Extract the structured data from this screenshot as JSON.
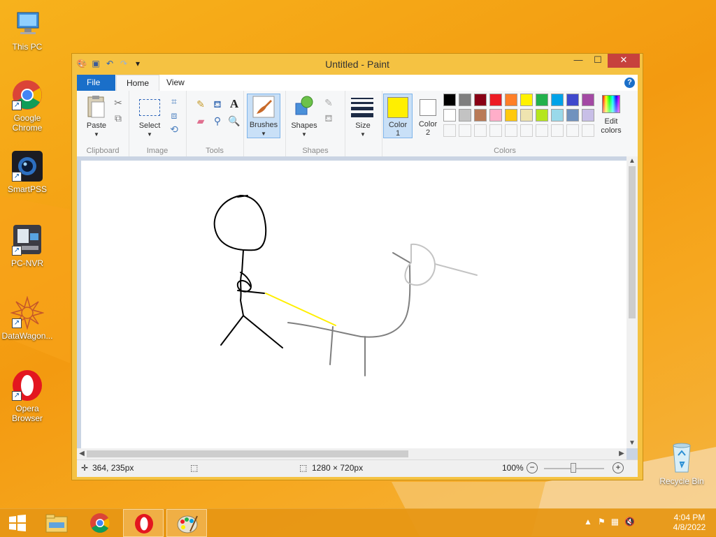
{
  "desktop": {
    "icons": [
      {
        "label": "This PC"
      },
      {
        "label": "Google Chrome"
      },
      {
        "label": "SmartPSS"
      },
      {
        "label": "PC-NVR"
      },
      {
        "label": "DataWagon..."
      },
      {
        "label": "Opera Browser"
      }
    ],
    "recycle_bin": "Recycle Bin"
  },
  "window": {
    "title": "Untitled - Paint",
    "minimize": "—",
    "maximize": "☐",
    "close": "✕"
  },
  "ribbon": {
    "tabs": {
      "file": "File",
      "home": "Home",
      "view": "View"
    },
    "clipboard": {
      "paste": "Paste",
      "label": "Clipboard"
    },
    "image": {
      "select": "Select",
      "label": "Image"
    },
    "tools": {
      "label": "Tools"
    },
    "brushes": {
      "label": "Brushes"
    },
    "shapes": {
      "shapes": "Shapes",
      "label": "Shapes"
    },
    "size": {
      "label": "Size"
    },
    "colors": {
      "color1": "Color",
      "color1_num": "1",
      "color2": "Color",
      "color2_num": "2",
      "edit_colors": "Edit colors",
      "label": "Colors",
      "color1_value": "#ffef00",
      "color2_value": "#ffffff",
      "palette_row1": [
        "#000000",
        "#7f7f7f",
        "#880015",
        "#ed1c24",
        "#ff7f27",
        "#fff200",
        "#22b14c",
        "#00a2e8",
        "#3f48cc",
        "#a349a4"
      ],
      "palette_row2": [
        "#ffffff",
        "#c3c3c3",
        "#b97a57",
        "#ffaec9",
        "#ffc90e",
        "#efe4b0",
        "#b5e61d",
        "#99d9ea",
        "#7092be",
        "#c8bfe7"
      ]
    }
  },
  "statusbar": {
    "cursor": "364, 235px",
    "canvas_size": "1280 × 720px",
    "zoom": "100%"
  },
  "taskbar": {
    "time": "4:04 PM",
    "date": "4/8/2022"
  }
}
